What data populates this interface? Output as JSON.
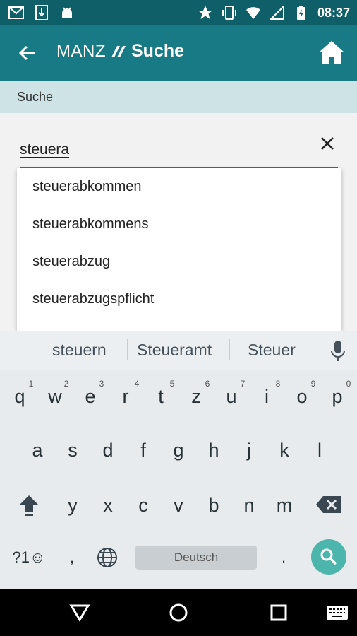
{
  "status_bar": {
    "time": "08:37",
    "icons": [
      "gmail-icon",
      "download-icon",
      "android-icon",
      "star-icon",
      "vibrate-icon",
      "wifi-icon",
      "no-signal-icon",
      "battery-charging-icon"
    ]
  },
  "app_bar": {
    "brand": "MANZ",
    "title": "Suche"
  },
  "breadcrumb": "Suche",
  "search": {
    "value": "steuera"
  },
  "suggestions": [
    "steuerabkommen",
    "steuerabkommens",
    "steuerabzug",
    "steuerabzugspflicht"
  ],
  "keyboard": {
    "suggestions": [
      "steuern",
      "Steueramt",
      "Steuer"
    ],
    "row1": [
      "q",
      "w",
      "e",
      "r",
      "t",
      "z",
      "u",
      "i",
      "o",
      "p"
    ],
    "row1_hints": [
      "1",
      "2",
      "3",
      "4",
      "5",
      "6",
      "7",
      "8",
      "9",
      "0"
    ],
    "row2": [
      "a",
      "s",
      "d",
      "f",
      "g",
      "h",
      "j",
      "k",
      "l"
    ],
    "row3": [
      "y",
      "x",
      "c",
      "v",
      "b",
      "n",
      "m"
    ],
    "symbols_label": "?1☺",
    "comma": ",",
    "period": ".",
    "space_label": "Deutsch"
  },
  "colors": {
    "status_bar": "#0f5f69",
    "app_bar": "#177a84",
    "band": "#cde3e6",
    "accent": "#4db6ac"
  }
}
